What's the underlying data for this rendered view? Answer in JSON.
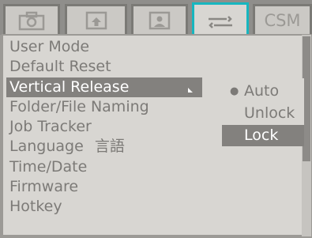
{
  "tabs": [
    {
      "icon": "camera-icon",
      "label": ""
    },
    {
      "icon": "playback-icon",
      "label": ""
    },
    {
      "icon": "person-icon",
      "label": ""
    },
    {
      "icon": "wrench-icon",
      "label": "",
      "active": true
    },
    {
      "icon": "",
      "label": "CSM"
    }
  ],
  "menu": {
    "items": [
      {
        "label": "User Mode"
      },
      {
        "label": "Default Reset"
      },
      {
        "label": "Vertical Release",
        "selected": true
      },
      {
        "label": "Folder/File Naming"
      },
      {
        "label": "Job Tracker"
      },
      {
        "label": "Language"
      },
      {
        "label": "Time/Date"
      },
      {
        "label": "Firmware"
      },
      {
        "label": "Hotkey"
      }
    ],
    "language_glyphs": "言語"
  },
  "submenu": {
    "options": [
      {
        "label": "Auto",
        "checked": true
      },
      {
        "label": "Unlock"
      },
      {
        "label": "Lock",
        "highlighted": true
      }
    ]
  }
}
